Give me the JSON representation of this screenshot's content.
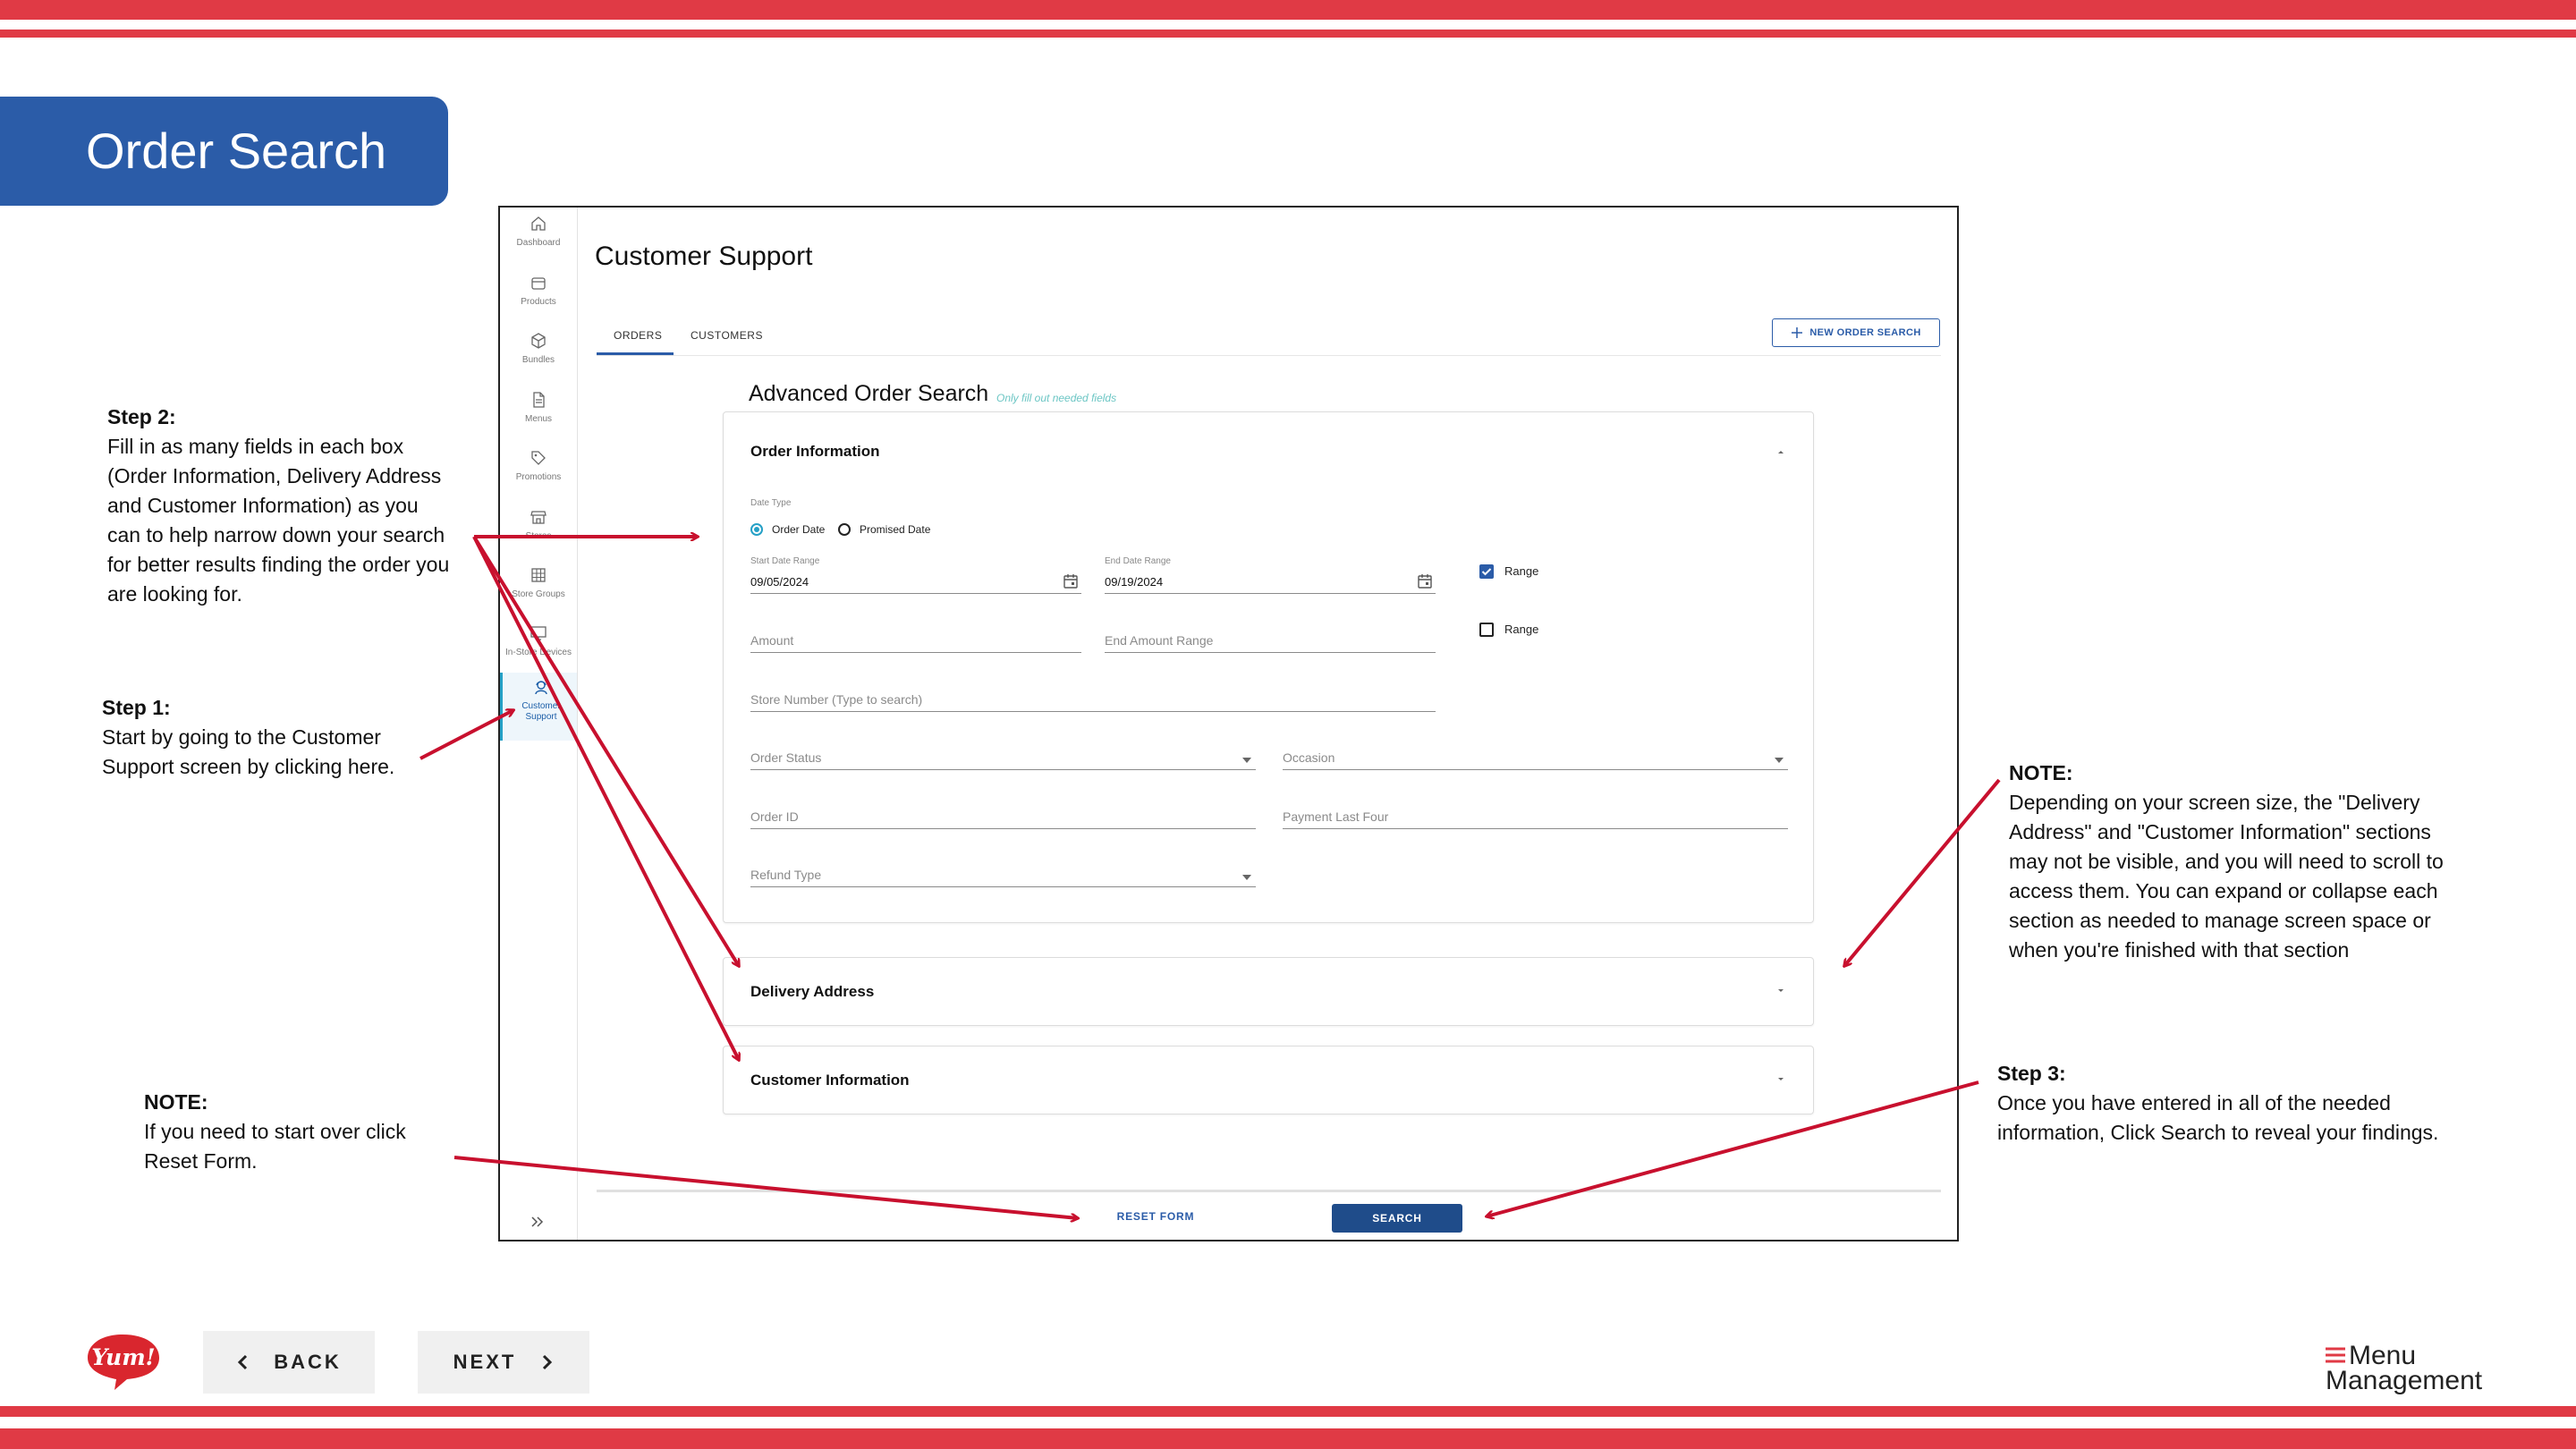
{
  "slide": {
    "title": "Order Search"
  },
  "annotations": {
    "step2": {
      "heading": "Step 2:",
      "body": "Fill in as many fields in each box (Order Information, Delivery Address and Customer Information) as you can to help narrow down your search for better results finding the order you are looking for."
    },
    "step1": {
      "heading": "Step 1:",
      "body": "Start by going to the Customer Support screen by clicking here."
    },
    "note_reset": {
      "heading": "NOTE:",
      "body": "If you need to start over click Reset Form."
    },
    "note_scroll": {
      "heading": "NOTE:",
      "body": "Depending on your screen size, the \"Delivery Address\" and \"Customer Information\" sections may not be visible, and you will need to scroll to access them. You can expand or collapse each section as needed to manage screen space or when you're finished with that section"
    },
    "step3": {
      "heading": "Step 3:",
      "body": "Once you have entered in all of the needed information, Click Search to reveal your findings."
    }
  },
  "sidebar": {
    "items": [
      {
        "label": "Dashboard",
        "icon": "home-icon"
      },
      {
        "label": "Products",
        "icon": "box-icon"
      },
      {
        "label": "Bundles",
        "icon": "cube-icon"
      },
      {
        "label": "Menus",
        "icon": "document-icon"
      },
      {
        "label": "Promotions",
        "icon": "tag-icon"
      },
      {
        "label": "Stores",
        "icon": "store-icon"
      },
      {
        "label": "Store Groups",
        "icon": "grid-icon"
      },
      {
        "label": "In-Store Devices",
        "icon": "monitor-icon"
      },
      {
        "label": "Customer Support",
        "icon": "support-agent-icon",
        "active": true
      }
    ],
    "expand_icon": "double-chevron-right-icon"
  },
  "page": {
    "heading": "Customer Support",
    "tabs": [
      {
        "label": "ORDERS",
        "active": true
      },
      {
        "label": "CUSTOMERS",
        "active": false
      }
    ],
    "new_order_search": "NEW ORDER SEARCH"
  },
  "advanced_search": {
    "title": "Advanced Order Search",
    "hint": "Only fill out needed fields",
    "order_information": {
      "title": "Order Information",
      "date_type_label": "Date Type",
      "radio_order_date": "Order Date",
      "radio_promised_date": "Promised Date",
      "selected_date_type": "Order Date",
      "start_date_label": "Start Date Range",
      "start_date_value": "09/05/2024",
      "end_date_label": "End Date Range",
      "end_date_value": "09/19/2024",
      "range_label_1": "Range",
      "range_1_checked": true,
      "amount_placeholder": "Amount",
      "end_amount_placeholder": "End Amount Range",
      "range_label_2": "Range",
      "range_2_checked": false,
      "store_number_placeholder": "Store Number (Type to search)",
      "order_status_placeholder": "Order Status",
      "occasion_placeholder": "Occasion",
      "order_id_placeholder": "Order ID",
      "payment_last_four_placeholder": "Payment Last Four",
      "refund_type_placeholder": "Refund Type"
    },
    "delivery_address": {
      "title": "Delivery Address"
    },
    "customer_information": {
      "title": "Customer Information"
    }
  },
  "actions": {
    "reset_form": "RESET FORM",
    "search": "SEARCH"
  },
  "footer": {
    "back": "BACK",
    "next": "NEXT",
    "yum_logo_text": "Yum!",
    "menu_management_line1": "Menu",
    "menu_management_line2": "Management"
  },
  "colors": {
    "stripe_red": "#e03a45",
    "title_blue": "#2b5ca8",
    "primary_button": "#1f4c8a",
    "arrow_red": "#c8102e",
    "hint_teal": "#6cc6c4"
  }
}
